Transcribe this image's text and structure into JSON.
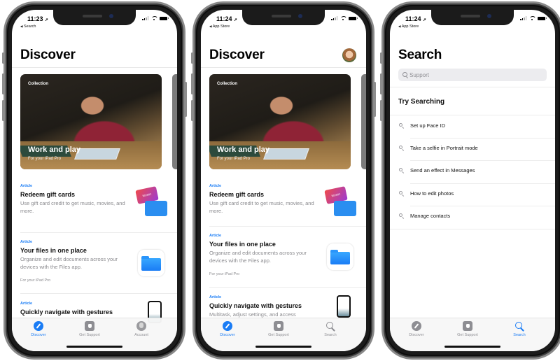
{
  "phones": [
    {
      "status": {
        "time": "11:23",
        "back_label": "Search"
      },
      "title": "Discover",
      "hero": {
        "eyebrow": "Collection",
        "title": "Work and play",
        "subtitle": "For your iPad Pro"
      },
      "articles": [
        {
          "eyebrow": "Article",
          "title": "Redeem gift cards",
          "description": "Use gift card credit to get music, movies, and more.",
          "footer": "",
          "thumb_icon": "gift-cards-icon",
          "thumb_text": "MUSIC"
        },
        {
          "eyebrow": "Article",
          "title": "Your files in one place",
          "description": "Organize and edit documents across your devices with the Files app.",
          "footer": "For your iPad Pro",
          "thumb_icon": "files-folder-icon"
        },
        {
          "eyebrow": "Article",
          "title": "Quickly navigate with gestures",
          "description": "",
          "footer": "",
          "thumb_icon": "iphone-gesture-icon"
        }
      ],
      "tabs": [
        {
          "label": "Discover",
          "icon": "compass-icon",
          "active": true
        },
        {
          "label": "Get Support",
          "icon": "support-icon",
          "active": false
        },
        {
          "label": "Account",
          "icon": "account-icon",
          "active": false
        }
      ]
    },
    {
      "status": {
        "time": "11:24",
        "back_label": "App Store"
      },
      "title": "Discover",
      "avatar": "profile-avatar",
      "hero": {
        "eyebrow": "Collection",
        "title": "Work and play",
        "subtitle": "For your iPad Pro"
      },
      "articles": [
        {
          "eyebrow": "Article",
          "title": "Redeem gift cards",
          "description": "Use gift card credit to get music, movies, and more.",
          "footer": "",
          "thumb_icon": "gift-cards-icon",
          "thumb_text": "MUSIC"
        },
        {
          "eyebrow": "Article",
          "title": "Your files in one place",
          "description": "Organize and edit documents across your devices with the Files app.",
          "footer": "For your iPad Pro",
          "thumb_icon": "files-folder-icon"
        },
        {
          "eyebrow": "Article",
          "title": "Quickly navigate with gestures",
          "description": "Multitask, adjust settings, and access",
          "footer": "",
          "thumb_icon": "iphone-gesture-icon"
        }
      ],
      "tabs": [
        {
          "label": "Discover",
          "icon": "compass-icon",
          "active": true
        },
        {
          "label": "Get Support",
          "icon": "support-icon",
          "active": false
        },
        {
          "label": "Search",
          "icon": "search-icon",
          "active": false
        }
      ]
    },
    {
      "status": {
        "time": "11:24",
        "back_label": "App Store"
      },
      "title": "Search",
      "search": {
        "placeholder": "Support",
        "value": ""
      },
      "try_title": "Try Searching",
      "suggestions": [
        "Set up Face ID",
        "Take a selfie in Portrait mode",
        "Send an effect in Messages",
        "How to edit photos",
        "Manage contacts"
      ],
      "tabs": [
        {
          "label": "Discover",
          "icon": "compass-icon",
          "active": false
        },
        {
          "label": "Get Support",
          "icon": "support-icon",
          "active": false
        },
        {
          "label": "Search",
          "icon": "search-icon",
          "active": true
        }
      ]
    }
  ],
  "colors": {
    "accent": "#1a7cf5",
    "inactive_tab": "#8e8e93",
    "secondary_text": "#8a8a8e"
  },
  "glyphs": {
    "location_arrow": "➚",
    "back_arrow": "◀",
    "apple_logo": ""
  }
}
